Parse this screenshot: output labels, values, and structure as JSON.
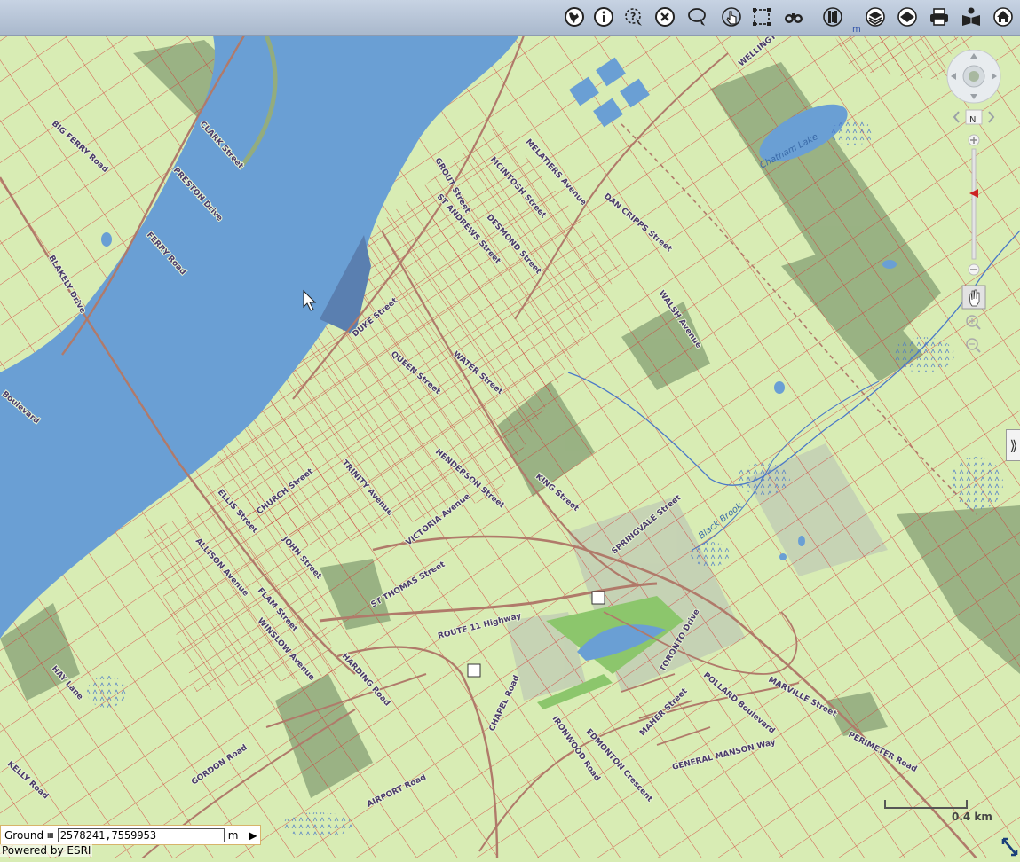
{
  "toolbar": {
    "tools": [
      {
        "name": "globe-icon",
        "title": "Map"
      },
      {
        "name": "info-icon",
        "title": "Identify"
      },
      {
        "name": "query-select-icon",
        "title": "Select"
      },
      {
        "name": "clear-icon",
        "title": "Clear"
      },
      {
        "name": "lasso-select-icon",
        "title": "Lasso"
      },
      {
        "name": "hand-pointer-icon",
        "title": "Point"
      },
      {
        "name": "extent-box-icon",
        "title": "Extent"
      },
      {
        "name": "binoculars-icon",
        "title": "Find"
      },
      {
        "name": "book-icon",
        "title": "Bookmarks"
      },
      {
        "name": "layers-icon",
        "title": "Layers"
      },
      {
        "name": "basemap-icon",
        "title": "Basemap"
      },
      {
        "name": "print-icon",
        "title": "Print"
      },
      {
        "name": "user-guide-icon",
        "title": "Help"
      },
      {
        "name": "home-icon",
        "title": "Home"
      }
    ],
    "unit_mark": "m"
  },
  "map": {
    "water_labels": [
      "Chatham Lake",
      "Black Brook"
    ],
    "road_labels": [
      "BIG FERRY Road",
      "CLARK Street",
      "PRESTON Drive",
      "FERRY Road",
      "BLAKELY Drive",
      "Boulevard",
      "GROUT Street",
      "MELATIERS Avenue",
      "MCINTOSH Street",
      "ST ANDREWS Street",
      "DESMOND Street",
      "DAN CRIPPS Street",
      "WALSH Avenue",
      "DUKE Street",
      "QUEEN Street",
      "WATER Street",
      "VICTORIA Avenue",
      "KING Street",
      "SPRINGVALE Street",
      "CHURCH Street",
      "HENDERSON Street",
      "TRINITY Avenue",
      "ELLIS Street",
      "JOHN Street",
      "ST THOMAS Street",
      "ROUTE 11 Highway",
      "HARDING Road",
      "CHAPEL Road",
      "IRONWOOD Road",
      "EDMONTON Crescent",
      "MAHER Street",
      "POLLARD Boulevard",
      "TORONTO Drive",
      "GENERAL MANSON Way",
      "MARVILLE Street",
      "PERIMETER Road",
      "GORDON Road",
      "AIRPORT Road",
      "KELLY Road",
      "HAY Lane",
      "WELLINGTON",
      "ALLISON Avenue",
      "FLAM Street",
      "WINSLOW Avenue"
    ]
  },
  "navigation": {
    "labels": {
      "north": "N"
    },
    "zoom_level_fraction": 0.6
  },
  "status": {
    "ground_label": "Ground",
    "coordinates": "2578241,7559953",
    "unit": "m"
  },
  "scale": {
    "label": "0.4 km"
  },
  "footer": {
    "powered_by": "Powered by ESRI"
  },
  "colors": {
    "water": "#6a9fd4",
    "land": "#d8ecb4",
    "parcel_line": "#d43434",
    "road": "#b07a6a",
    "dark_green": "#93ac7e",
    "toolbar": "#b9c6d8"
  }
}
